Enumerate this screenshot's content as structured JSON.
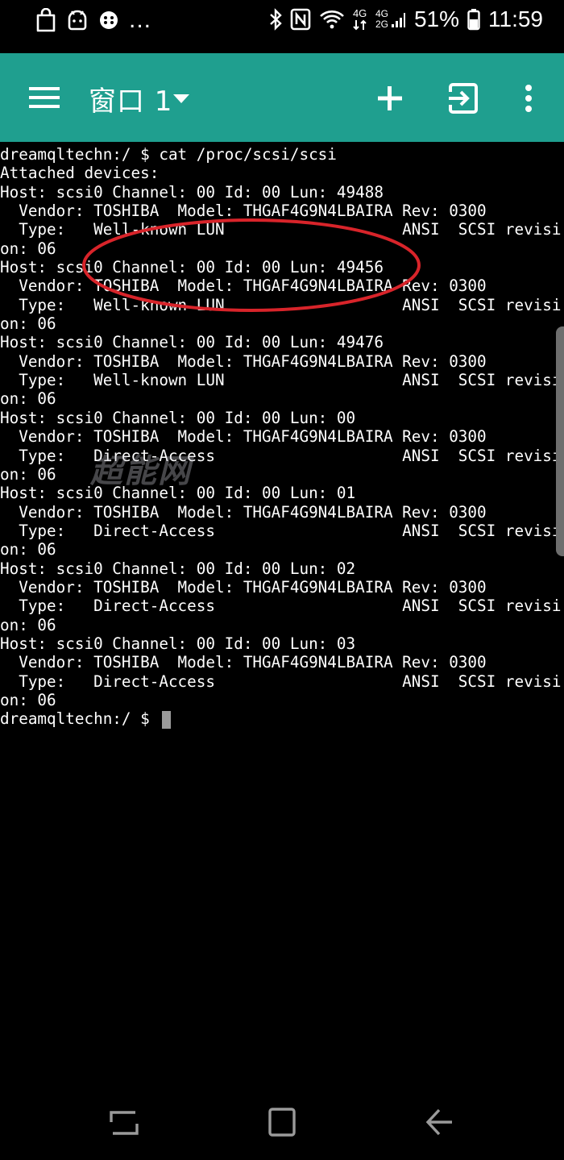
{
  "status_bar": {
    "battery_percent": "51%",
    "time": "11:59",
    "network_top": "4G",
    "network_dual_top": "4G",
    "network_dual_bottom": "2G",
    "overflow": "..."
  },
  "app_bar": {
    "window_title": "窗口 1",
    "icons": [
      "menu-icon",
      "chevron-down-icon",
      "add-icon",
      "exit-icon",
      "more-icon"
    ],
    "color": "#1f9f8f"
  },
  "terminal": {
    "lines": [
      "dreamqltechn:/ $ cat /proc/scsi/scsi",
      "Attached devices:",
      "Host: scsi0 Channel: 00 Id: 00 Lun: 49488",
      "  Vendor: TOSHIBA  Model: THGAF4G9N4LBAIRA Rev: 0300",
      "  Type:   Well-known LUN                   ANSI  SCSI revisi",
      "on: 06",
      "Host: scsi0 Channel: 00 Id: 00 Lun: 49456",
      "  Vendor: TOSHIBA  Model: THGAF4G9N4LBAIRA Rev: 0300",
      "  Type:   Well-known LUN                   ANSI  SCSI revisi",
      "on: 06",
      "Host: scsi0 Channel: 00 Id: 00 Lun: 49476",
      "  Vendor: TOSHIBA  Model: THGAF4G9N4LBAIRA Rev: 0300",
      "  Type:   Well-known LUN                   ANSI  SCSI revisi",
      "on: 06",
      "Host: scsi0 Channel: 00 Id: 00 Lun: 00",
      "  Vendor: TOSHIBA  Model: THGAF4G9N4LBAIRA Rev: 0300",
      "  Type:   Direct-Access                    ANSI  SCSI revisi",
      "on: 06",
      "Host: scsi0 Channel: 00 Id: 00 Lun: 01",
      "  Vendor: TOSHIBA  Model: THGAF4G9N4LBAIRA Rev: 0300",
      "  Type:   Direct-Access                    ANSI  SCSI revisi",
      "on: 06",
      "Host: scsi0 Channel: 00 Id: 00 Lun: 02",
      "  Vendor: TOSHIBA  Model: THGAF4G9N4LBAIRA Rev: 0300",
      "  Type:   Direct-Access                    ANSI  SCSI revisi",
      "on: 06",
      "Host: scsi0 Channel: 00 Id: 00 Lun: 03",
      "  Vendor: TOSHIBA  Model: THGAF4G9N4LBAIRA Rev: 0300",
      "  Type:   Direct-Access                    ANSI  SCSI revisi",
      "on: 06"
    ],
    "prompt": "dreamqltechn:/ $ ",
    "highlight_color": "#d8242a",
    "watermark": "超能网"
  },
  "nav_bar": {
    "icons": [
      "recent-apps-icon",
      "home-icon",
      "back-icon"
    ]
  }
}
